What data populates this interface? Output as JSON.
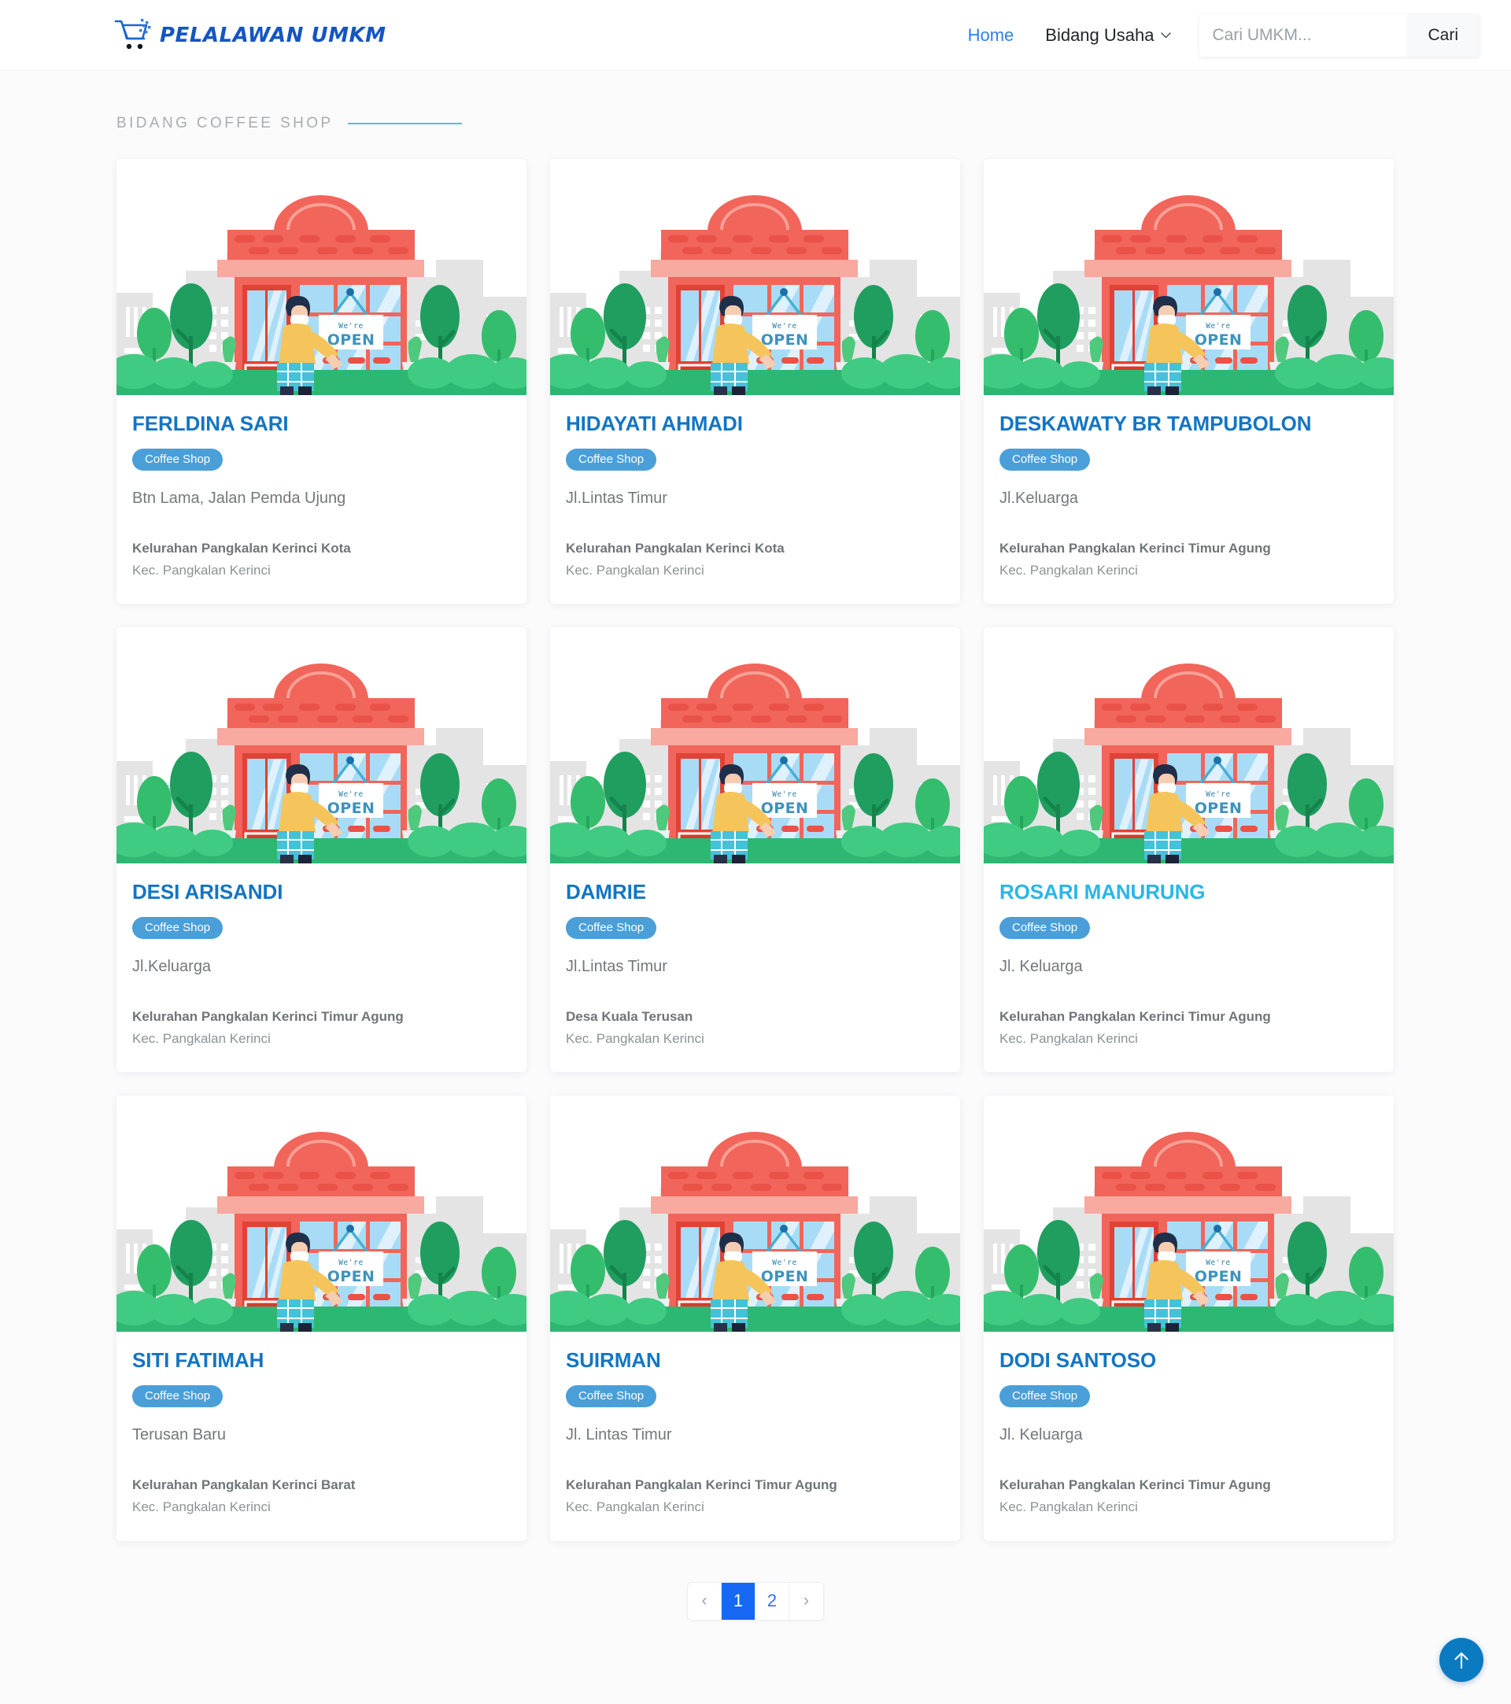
{
  "brand": {
    "name": "PELALAWAN UMKM",
    "logo_icon": "shopping-cart-icon"
  },
  "nav": {
    "home_label": "Home",
    "bidang_usaha_label": "Bidang Usaha",
    "caret_icon": "chevron-down-icon"
  },
  "search": {
    "placeholder": "Cari UMKM...",
    "value": "",
    "button_label": "Cari"
  },
  "section": {
    "title": "BIDANG COFFEE SHOP",
    "rule_color": "#45c3e8"
  },
  "colors": {
    "brand_blue": "#1455c4",
    "link_blue": "#2f80ed",
    "card_title": "#1275c4",
    "card_title_hover": "#29b6e8",
    "badge": "#4a9fd8",
    "pagination_active": "#1668f5",
    "scroll_top": "#0b7bc1"
  },
  "card_illustration": {
    "alt": "storefront-we-are-open-illustration",
    "sign_line1": "We're",
    "sign_line2": "OPEN"
  },
  "cards": [
    {
      "name": "FERLDINA SARI",
      "badge": "Coffee Shop",
      "address": "Btn Lama, Jalan Pemda Ujung",
      "kelurahan": "Kelurahan Pangkalan Kerinci Kota",
      "kecamatan": "Kec. Pangkalan Kerinci",
      "hover": false
    },
    {
      "name": "HIDAYATI AHMADI",
      "badge": "Coffee Shop",
      "address": "Jl.Lintas Timur",
      "kelurahan": "Kelurahan Pangkalan Kerinci Kota",
      "kecamatan": "Kec. Pangkalan Kerinci",
      "hover": false
    },
    {
      "name": "DESKAWATY BR TAMPUBOLON",
      "badge": "Coffee Shop",
      "address": "Jl.Keluarga",
      "kelurahan": "Kelurahan Pangkalan Kerinci Timur Agung",
      "kecamatan": "Kec. Pangkalan Kerinci",
      "hover": false
    },
    {
      "name": "DESI ARISANDI",
      "badge": "Coffee Shop",
      "address": "Jl.Keluarga",
      "kelurahan": "Kelurahan Pangkalan Kerinci Timur Agung",
      "kecamatan": "Kec. Pangkalan Kerinci",
      "hover": false
    },
    {
      "name": "DAMRIE",
      "badge": "Coffee Shop",
      "address": "Jl.Lintas Timur",
      "kelurahan": "Desa Kuala Terusan",
      "kecamatan": "Kec. Pangkalan Kerinci",
      "hover": false
    },
    {
      "name": "ROSARI MANURUNG",
      "badge": "Coffee Shop",
      "address": "Jl. Keluarga",
      "kelurahan": "Kelurahan Pangkalan Kerinci Timur Agung",
      "kecamatan": "Kec. Pangkalan Kerinci",
      "hover": true
    },
    {
      "name": "SITI FATIMAH",
      "badge": "Coffee Shop",
      "address": "Terusan Baru",
      "kelurahan": "Kelurahan Pangkalan Kerinci Barat",
      "kecamatan": "Kec. Pangkalan Kerinci",
      "hover": false
    },
    {
      "name": "SUIRMAN",
      "badge": "Coffee Shop",
      "address": "Jl. Lintas Timur",
      "kelurahan": "Kelurahan Pangkalan Kerinci Timur Agung",
      "kecamatan": "Kec. Pangkalan Kerinci",
      "hover": false
    },
    {
      "name": "DODI SANTOSO",
      "badge": "Coffee Shop",
      "address": "Jl. Keluarga",
      "kelurahan": "Kelurahan Pangkalan Kerinci Timur Agung",
      "kecamatan": "Kec. Pangkalan Kerinci",
      "hover": false
    }
  ],
  "pagination": {
    "prev_label": "‹",
    "next_label": "›",
    "pages": [
      "1",
      "2"
    ],
    "active": "1"
  },
  "scroll_top": {
    "icon": "arrow-up-icon"
  }
}
